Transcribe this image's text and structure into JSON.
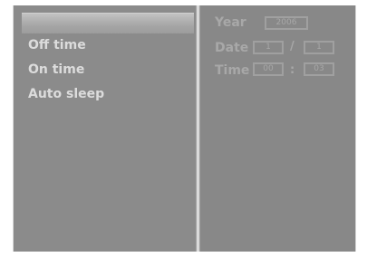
{
  "menu": {
    "items": [
      {
        "label": "Off time"
      },
      {
        "label": "On time"
      },
      {
        "label": "Auto sleep"
      }
    ]
  },
  "clock": {
    "year_label": "Year",
    "year_value": "2006",
    "date_label": "Date",
    "date_month": "1",
    "date_separator": "/",
    "date_day": "1",
    "time_label": "Time",
    "time_hour": "00",
    "time_separator": ":",
    "time_minute": "03"
  },
  "colors": {
    "panel": "#8a8a8a",
    "menu_text": "#dcdcdc",
    "dim_text": "#a8a8a8"
  }
}
